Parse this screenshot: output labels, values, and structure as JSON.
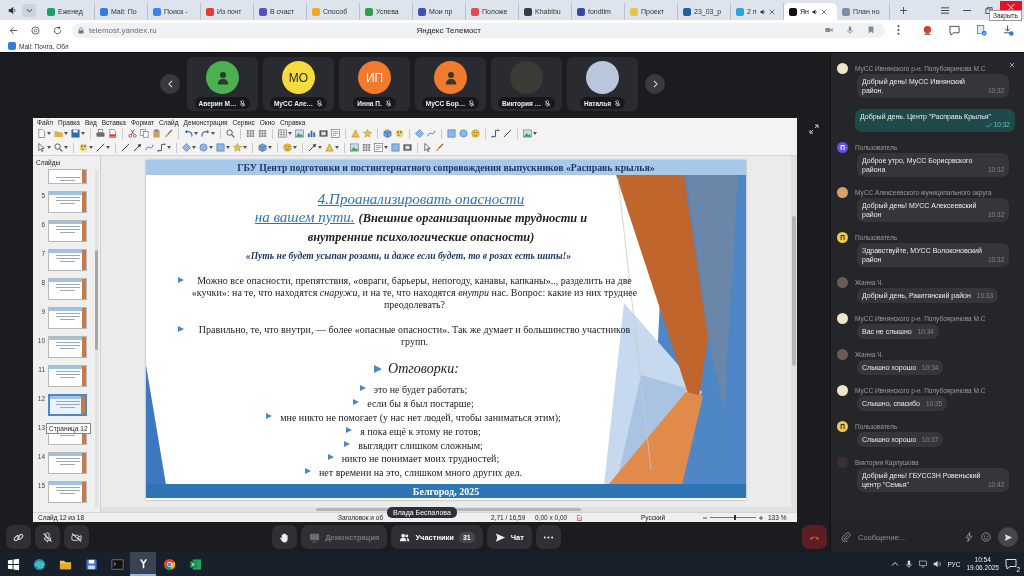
{
  "browser": {
    "tabs": [
      {
        "title": "Еженед",
        "color": "#1e9e6a",
        "selected": false,
        "audio": false,
        "closable": false
      },
      {
        "title": "Mail: По",
        "color": "#2f7de1",
        "selected": false,
        "audio": false,
        "closable": false
      },
      {
        "title": "Поиск -",
        "color": "#3b82f6",
        "selected": false,
        "audio": false,
        "closable": false
      },
      {
        "title": "Из почт",
        "color": "#e53935",
        "selected": false,
        "audio": false,
        "closable": false
      },
      {
        "title": "В счаст",
        "color": "#5b4bc4",
        "selected": false,
        "audio": false,
        "closable": false
      },
      {
        "title": "Способ",
        "color": "#f5a623",
        "selected": false,
        "audio": false,
        "closable": false
      },
      {
        "title": "Успева",
        "color": "#2e9e4f",
        "selected": false,
        "audio": false,
        "closable": false
      },
      {
        "title": "Мои пр",
        "color": "#3f51b5",
        "selected": false,
        "audio": false,
        "closable": false
      },
      {
        "title": "Положе",
        "color": "#e5484d",
        "selected": false,
        "audio": false,
        "closable": false
      },
      {
        "title": "Khabibu",
        "color": "#3a3a4a",
        "selected": false,
        "audio": false,
        "closable": false
      },
      {
        "title": "fondtim",
        "color": "#3949ab",
        "selected": false,
        "audio": false,
        "closable": false
      },
      {
        "title": "Проект",
        "color": "#e8c34a",
        "selected": false,
        "audio": false,
        "closable": false
      },
      {
        "title": "23_03_р",
        "color": "#1f5fa8",
        "selected": false,
        "audio": false,
        "closable": false
      },
      {
        "title": "2 п",
        "color": "#2aa3e0",
        "selected": false,
        "audio": true,
        "closable": true
      },
      {
        "title": "Ян",
        "color": "#111111",
        "selected": true,
        "audio": true,
        "closable": true
      },
      {
        "title": "План но",
        "color": "#7d8fa8",
        "selected": false,
        "audio": false,
        "closable": false
      }
    ],
    "tooltip": "Закрыть",
    "url": "telemost.yandex.ru",
    "page_title": "Яндекс Телемост",
    "bookmarks": [
      {
        "title": "Mail: Почта, Обл",
        "color": "#2f7de1"
      }
    ]
  },
  "participants": [
    {
      "name": "Аверин М…",
      "kind": "icon",
      "color": "#4caf50",
      "muted": true
    },
    {
      "name": "МуСС Але…",
      "kind": "initials",
      "initials": "МО",
      "color": "#f5dc3c",
      "muted": true
    },
    {
      "name": "Инна П.",
      "kind": "initials",
      "initials": "ИП",
      "color": "#f07a2e",
      "muted": true
    },
    {
      "name": "МуСС Бор…",
      "kind": "icon",
      "color": "#f07a2e",
      "muted": true
    },
    {
      "name": "Виктория …",
      "kind": "photo",
      "color": "#3b3a34",
      "muted": true
    },
    {
      "name": "Наталья",
      "kind": "photo",
      "color": "#b9c6dc",
      "muted": true
    }
  ],
  "screen_share": {
    "presenter": "Влада Беспалова",
    "app": {
      "menu": [
        "Файл",
        "Правка",
        "Вид",
        "Вставка",
        "Формат",
        "Слайд",
        "Демонстрация",
        "Сервис",
        "Окно",
        "Справка"
      ],
      "panel_title": "Слайды",
      "slides": [
        {
          "number": "5",
          "selected": false
        },
        {
          "number": "6",
          "selected": false
        },
        {
          "number": "7",
          "selected": false
        },
        {
          "number": "8",
          "selected": false
        },
        {
          "number": "9",
          "selected": false
        },
        {
          "number": "10",
          "selected": false
        },
        {
          "number": "11",
          "selected": false
        },
        {
          "number": "12",
          "selected": true
        },
        {
          "number": "13",
          "selected": false
        },
        {
          "number": "14",
          "selected": false
        },
        {
          "number": "15",
          "selected": false
        }
      ],
      "slide_tooltip": "Страница 12",
      "slide": {
        "header": "ГБУ Центр подготовки и постинтернатного сопровождения выпускников «Расправь крылья»",
        "title": {
          "underlined": [
            "4.Проанализировать опасности",
            "на вашем пути."
          ],
          "note": "(Внешние организационные трудности и внутренние психологические опасности)"
        },
        "quote": "«Путь не будет усыпан розами, и даже если будет, то в розах есть шипы!»",
        "bullets": [
          "Можно все опасности, препятствия, «овраги, барьеры, непогоду, канавы, капканы».., разделить на две «кучки»: на те, что находятся *снаружи*, и на те, что находятся *внутри* нас. Вопрос: какие из них труднее преодолевать?",
          "Правильно, те, что внутри, — более «опасные опасности». Так же думает и большинство участников групп."
        ],
        "heading": "Отговорки:",
        "excuses": [
          "это не будет работать;",
          "если бы я был постарше;",
          "мне никто не помогает (у нас нет людей, чтобы заниматься этим);",
          "я пока ещё к этому не готов;",
          "выглядит слишком сложным;",
          "никто не понимает моих трудностей;",
          "нет времени на это, слишком много других дел."
        ],
        "footer": "Белгород, 2025"
      },
      "status": {
        "slide": "Слайд 12 из 18",
        "layout": "Заголовок и об",
        "position": "2,71 / 16,59",
        "size": "0,00 x 0,00",
        "language": "Русский",
        "zoom": "133 %",
        "zoom_slider": {
          "level": 0.55
        }
      }
    }
  },
  "controls": {
    "microphone": {
      "on": false
    },
    "camera": {
      "on": false
    },
    "share": {
      "label": "Демонстрация",
      "disabled": true
    },
    "participants": {
      "label": "Участники",
      "count": "31"
    },
    "chat": {
      "label": "Чат"
    }
  },
  "chat": {
    "messages": [
      {
        "kind": "incoming",
        "author": "МуСС Ивнянского р-н. Полубояринова М.С",
        "avatar": {
          "kind": "picture",
          "color": "#efe6c8"
        },
        "text": "Добрый день! МуСС Ивнянский район.",
        "time": "10:32"
      },
      {
        "kind": "outgoing",
        "text": "Добрый день. Центр \"Расправь Крылья\"",
        "time": "10:32",
        "read": true
      },
      {
        "kind": "incoming",
        "author": "Пользователь",
        "avatar": {
          "kind": "letter",
          "letter": "П",
          "color": "#6a4de0"
        },
        "text": "Доброе утро, МуСС Борисрвского района",
        "time": "10:32"
      },
      {
        "kind": "incoming",
        "author": "МуСС Алексеевского муниципального округа",
        "avatar": {
          "kind": "picture",
          "color": "#d9a06a"
        },
        "text": "Добрый день! МУСС Алексеевский район",
        "time": "10:32"
      },
      {
        "kind": "incoming",
        "author": "Пользователь",
        "avatar": {
          "kind": "letter",
          "letter": "П",
          "color": "#f2c94c"
        },
        "text": "Здравствуйте, МУСС Волоконовский район",
        "time": "10:32"
      },
      {
        "kind": "incoming",
        "author": "Жанна Ч.",
        "avatar": {
          "kind": "picture",
          "color": "#6b5a55"
        },
        "text": "Добрый день, Ракитянский район",
        "time": "10:33"
      },
      {
        "kind": "incoming",
        "author": "МуСС Ивнянского р-н. Полубояринова М.С",
        "avatar": {
          "kind": "picture",
          "color": "#efe6c8"
        },
        "text": "Вас не слышно",
        "time": "10:34"
      },
      {
        "kind": "incoming",
        "author": "Жанна Ч.",
        "avatar": {
          "kind": "picture",
          "color": "#6b5a55"
        },
        "text": "Слышно хорошо",
        "time": "10:34"
      },
      {
        "kind": "incoming",
        "author": "МуСС Ивнянского р-н. Полубояринова М.С",
        "avatar": {
          "kind": "picture",
          "color": "#efe6c8"
        },
        "text": "Слышно, спасибо",
        "time": "10:35"
      },
      {
        "kind": "incoming",
        "author": "Пользователь",
        "avatar": {
          "kind": "letter",
          "letter": "П",
          "color": "#f2c94c"
        },
        "text": "Слышно хорошо",
        "time": "10:37"
      },
      {
        "kind": "incoming",
        "author": "Виктория Карлушова",
        "avatar": {
          "kind": "picture",
          "color": "#3a3030"
        },
        "text": "Добрый день! ГБУССЗН Ровеньский центр \"Семья\"",
        "time": "10:42"
      }
    ],
    "input": {
      "placeholder": "Сообщение..."
    }
  },
  "taskbar": {
    "apps": [
      {
        "kind": "start",
        "selected": false
      },
      {
        "kind": "swirl",
        "selected": false
      },
      {
        "kind": "folder",
        "selected": false
      },
      {
        "kind": "floppy",
        "selected": false
      },
      {
        "kind": "terminal",
        "selected": false
      },
      {
        "kind": "y",
        "selected": true
      },
      {
        "kind": "ring",
        "selected": false
      },
      {
        "kind": "sheet",
        "selected": false
      }
    ],
    "language": "РУС",
    "time": "10:54",
    "date": "19.06.2025",
    "notifications": "2"
  }
}
